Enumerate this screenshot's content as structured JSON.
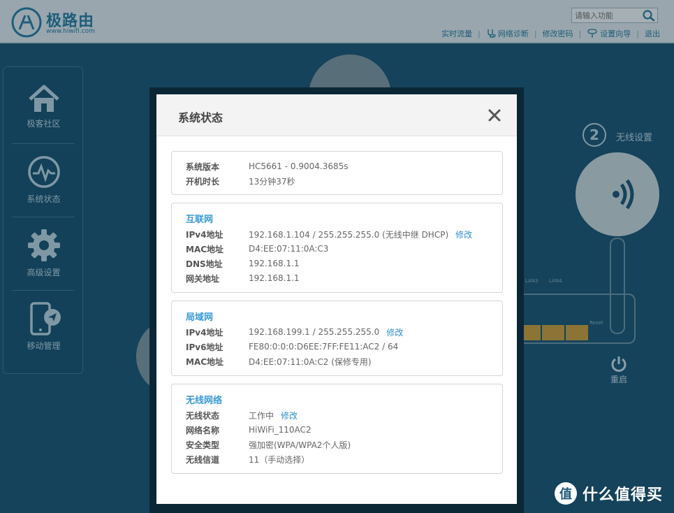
{
  "brand": {
    "name": "极路由",
    "domain": "www.hiwifi.com",
    "accent_color": "#2a7fa3"
  },
  "header": {
    "search_placeholder": "请输入功能",
    "links": [
      {
        "label": "实时流量",
        "icon": ""
      },
      {
        "label": "网络诊断",
        "icon": "stethoscope-icon"
      },
      {
        "label": "修改密码",
        "icon": ""
      },
      {
        "label": "设置向导",
        "icon": "wand-icon"
      },
      {
        "label": "退出",
        "icon": ""
      }
    ]
  },
  "sidebar": {
    "items": [
      {
        "label": "极客社区",
        "icon": "home-icon"
      },
      {
        "label": "系统状态",
        "icon": "pulse-icon"
      },
      {
        "label": "高级设置",
        "icon": "gear-icon"
      },
      {
        "label": "移动管理",
        "icon": "mobile-icon"
      }
    ]
  },
  "background": {
    "wireless_step": "2",
    "wireless_label": "无线设置",
    "lan_labels": [
      "LAN3",
      "LAN4"
    ],
    "reset_label": "Reset",
    "reboot_label": "重启"
  },
  "modal": {
    "title": "系统状态",
    "close_icon": "close-icon",
    "system": {
      "rows": [
        {
          "key": "系统版本",
          "value": "HC5661 - 0.9004.3685s"
        },
        {
          "key": "开机时长",
          "value": "13分钟37秒"
        }
      ]
    },
    "internet": {
      "title": "互联网",
      "rows": [
        {
          "key": "IPv4地址",
          "value": "192.168.1.104 / 255.255.255.0 (无线中继 DHCP)",
          "action": "修改"
        },
        {
          "key": "MAC地址",
          "value": "D4:EE:07:11:0A:C3"
        },
        {
          "key": "DNS地址",
          "value": "192.168.1.1"
        },
        {
          "key": "网关地址",
          "value": "192.168.1.1"
        }
      ]
    },
    "lan": {
      "title": "局域网",
      "rows": [
        {
          "key": "IPv4地址",
          "value": "192.168.199.1 / 255.255.255.0",
          "action": "修改"
        },
        {
          "key": "IPv6地址",
          "value": "FE80:0:0:0:D6EE:7FF:FE11:AC2 / 64"
        },
        {
          "key": "MAC地址",
          "value": "D4:EE:07:11:0A:C2 (保修专用)"
        }
      ]
    },
    "wireless": {
      "title": "无线网络",
      "rows": [
        {
          "key": "无线状态",
          "value": "工作中",
          "action": "修改"
        },
        {
          "key": "网络名称",
          "value": "HiWiFi_110AC2"
        },
        {
          "key": "安全类型",
          "value": "强加密(WPA/WPA2个人版)"
        },
        {
          "key": "无线信道",
          "value": "11（手动选择）"
        }
      ]
    }
  },
  "watermark": {
    "text": "什么值得买",
    "glyph": "值"
  }
}
